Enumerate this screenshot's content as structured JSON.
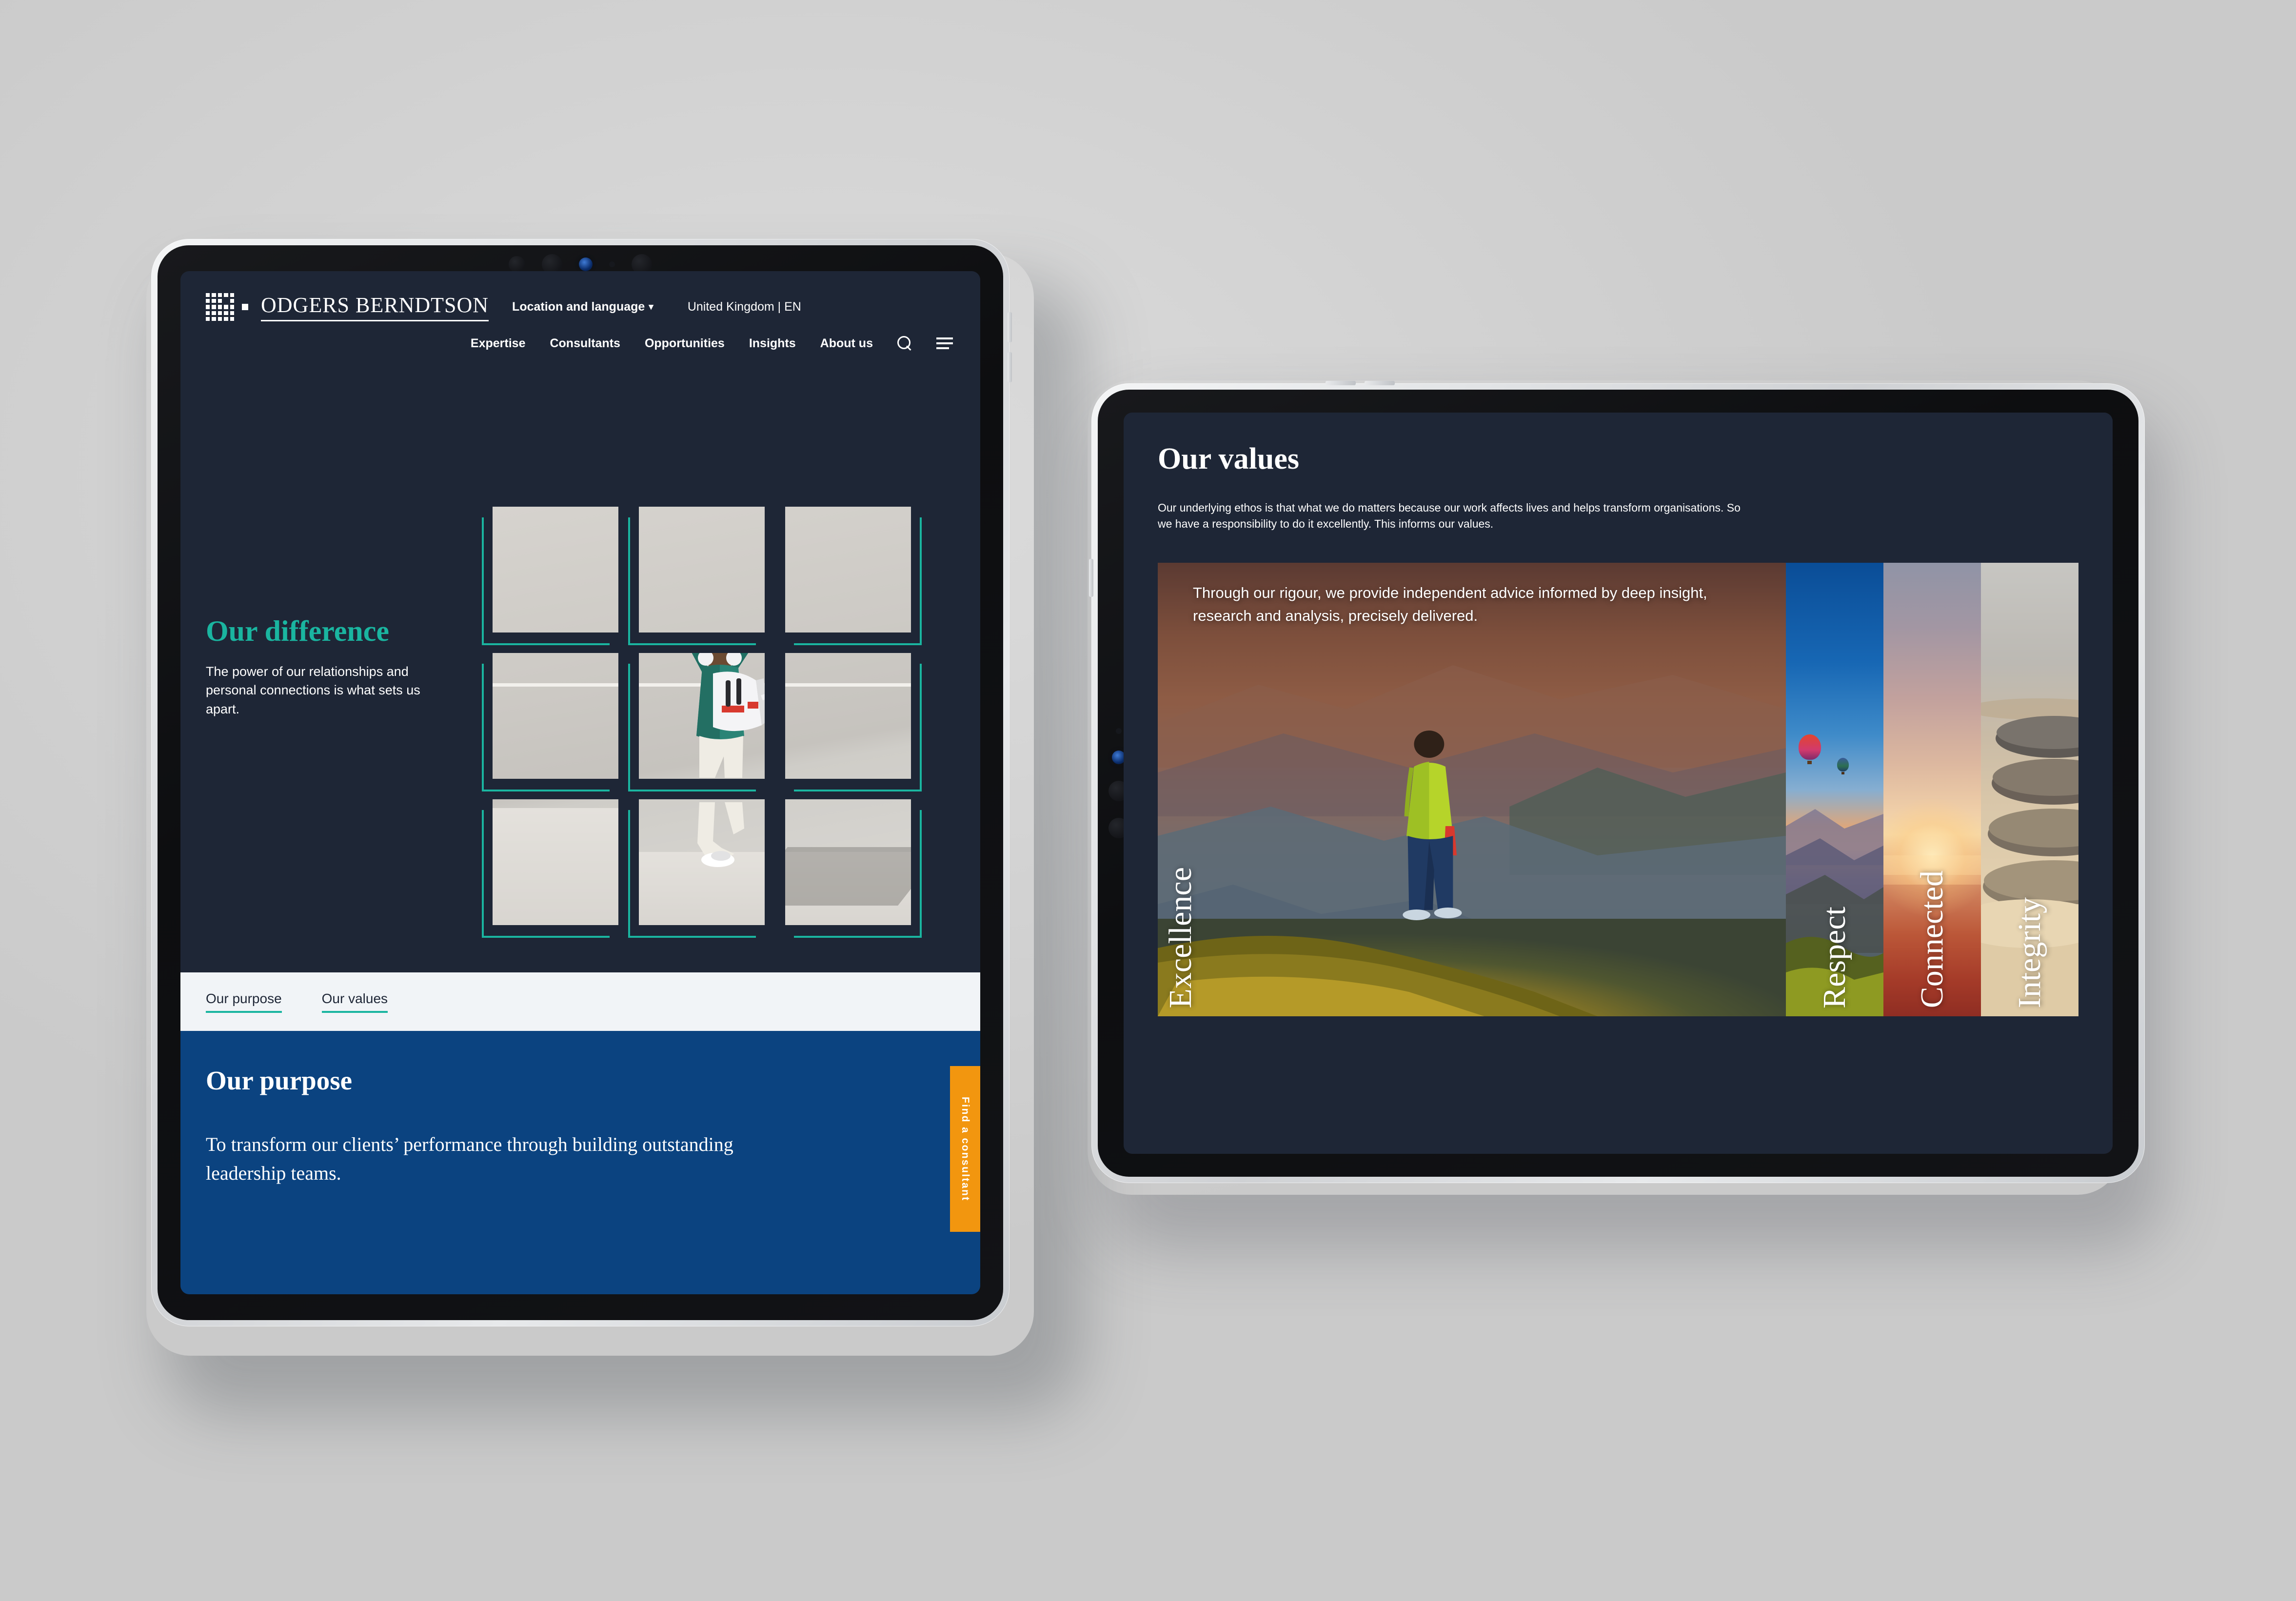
{
  "scene": {
    "background_color": "#d4d4d4",
    "device_count": 2
  },
  "left_device": {
    "orientation": "portrait",
    "header": {
      "brand_name": "ODGERS BERNDTSON",
      "logo_icon": "odgers-grid-logo",
      "location_language_label": "Location and language",
      "chevron_icon": "chevron-down-icon",
      "region_label": "United Kingdom | EN",
      "nav_items": [
        {
          "label": "Expertise"
        },
        {
          "label": "Consultants"
        },
        {
          "label": "Opportunities"
        },
        {
          "label": "Insights"
        },
        {
          "label": "About us"
        }
      ],
      "search_icon": "search-icon",
      "menu_icon": "hamburger-menu-icon"
    },
    "hero": {
      "title": "Our difference",
      "title_color": "#1ab5a0",
      "body": "The power of our relationships and personal connections is what sets us apart.",
      "grid_alt": "Person in green jacket with white backpack jumping against concrete wall, split into a 3x3 tile grid",
      "grid_accent_color": "#1ab5a0",
      "grid_rows": 3,
      "grid_cols": 3
    },
    "tabs": [
      {
        "label": "Our purpose",
        "active": true
      },
      {
        "label": "Our values",
        "active": true
      }
    ],
    "purpose": {
      "background_color": "#0b4380",
      "title": "Our purpose",
      "body": "To transform our clients’ performance through building outstanding leadership teams."
    },
    "side_cta": {
      "label": "Find a consultant",
      "background_color": "#f2960f"
    }
  },
  "right_device": {
    "orientation": "landscape",
    "values_page": {
      "title": "Our values",
      "intro": "Our underlying ethos is that what we do matters because our work affects lives and helps transform organisations. So we have a responsibility to do it excellently. This informs our values.",
      "panels": [
        {
          "label": "Excellence",
          "state": "expanded",
          "body": "Through our rigour, we provide independent advice informed by deep insight, research and analysis, precisely delivered.",
          "image_alt": "Hiker in lime green jacket standing on a grassy summit overlooking layered mountains at sunset"
        },
        {
          "label": "Respect",
          "state": "collapsed",
          "image_alt": "Hot air balloons floating over misty hills at sunrise with deep blue sky"
        },
        {
          "label": "Connected",
          "state": "collapsed",
          "image_alt": "Warm sunset gradient over the horizon"
        },
        {
          "label": "Integrity",
          "state": "collapsed",
          "image_alt": "Stack of smooth balanced zen stones on sand"
        }
      ]
    }
  }
}
